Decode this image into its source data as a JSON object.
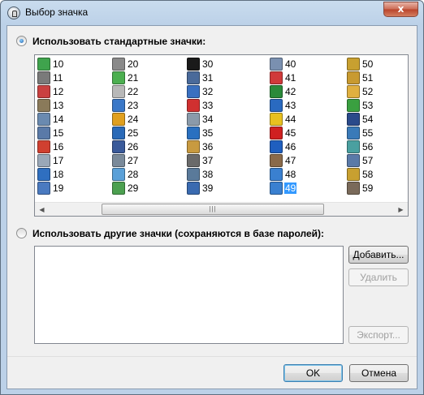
{
  "window": {
    "title": "Выбор значка",
    "close_label": "x"
  },
  "standard": {
    "label": "Использовать стандартные значки:",
    "selected": true,
    "selected_icon": "49",
    "columns": [
      [
        {
          "num": "10",
          "icon": "checkmark-doc-icon",
          "color": "#3fa34d"
        },
        {
          "num": "11",
          "icon": "camera-icon",
          "color": "#7a7a7a"
        },
        {
          "num": "12",
          "icon": "clock-icon",
          "color": "#c94040"
        },
        {
          "num": "13",
          "icon": "tools-icon",
          "color": "#8a7a5a"
        },
        {
          "num": "14",
          "icon": "disk-drive-icon",
          "color": "#6a8ab0"
        },
        {
          "num": "15",
          "icon": "printer-icon",
          "color": "#5a7aa8"
        },
        {
          "num": "16",
          "icon": "star-burst-icon",
          "color": "#d04030"
        },
        {
          "num": "17",
          "icon": "cd-icon",
          "color": "#9aa8b8"
        },
        {
          "num": "18",
          "icon": "monitor-icon",
          "color": "#2f6fc0"
        },
        {
          "num": "19",
          "icon": "mail-icon",
          "color": "#4a7ac0"
        }
      ],
      [
        {
          "num": "20",
          "icon": "gear-icon",
          "color": "#8a8a8a"
        },
        {
          "num": "21",
          "icon": "notepad-icon",
          "color": "#4caf50"
        },
        {
          "num": "22",
          "icon": "document-icon",
          "color": "#b8b8b8"
        },
        {
          "num": "23",
          "icon": "screen-icon",
          "color": "#3a78c8"
        },
        {
          "num": "24",
          "icon": "people-icon",
          "color": "#e0a020"
        },
        {
          "num": "25",
          "icon": "network-icon",
          "color": "#2a6ab8"
        },
        {
          "num": "26",
          "icon": "save-disk-icon",
          "color": "#3a5a9a"
        },
        {
          "num": "27",
          "icon": "computer-icon",
          "color": "#7a8a9a"
        },
        {
          "num": "28",
          "icon": "search-doc-icon",
          "color": "#5aa0d8"
        },
        {
          "num": "29",
          "icon": "ticket-icon",
          "color": "#4ca050"
        }
      ],
      [
        {
          "num": "30",
          "icon": "console-icon",
          "color": "#1a1a1a"
        },
        {
          "num": "31",
          "icon": "printer-2-icon",
          "color": "#4a6a9a"
        },
        {
          "num": "32",
          "icon": "grid-icon",
          "color": "#3a70c0"
        },
        {
          "num": "33",
          "icon": "puzzle-icon",
          "color": "#d03030"
        },
        {
          "num": "34",
          "icon": "wrench-icon",
          "color": "#8a9aaa"
        },
        {
          "num": "35",
          "icon": "users-icon",
          "color": "#2a70c0"
        },
        {
          "num": "36",
          "icon": "package-icon",
          "color": "#c89a40"
        },
        {
          "num": "37",
          "icon": "percent-icon",
          "color": "#6a6a6a"
        },
        {
          "num": "38",
          "icon": "terminal-icon",
          "color": "#5a7a9a"
        },
        {
          "num": "39",
          "icon": "stopwatch-icon",
          "color": "#3a6ab0"
        }
      ],
      [
        {
          "num": "40",
          "icon": "envelope-icon",
          "color": "#7a90b0"
        },
        {
          "num": "41",
          "icon": "thumbs-icon",
          "color": "#d03a3a"
        },
        {
          "num": "42",
          "icon": "chip-icon",
          "color": "#2a8a3a"
        },
        {
          "num": "43",
          "icon": "database-icon",
          "color": "#2a6ac0"
        },
        {
          "num": "44",
          "icon": "sticky-note-icon",
          "color": "#e8c020"
        },
        {
          "num": "45",
          "icon": "cross-icon",
          "color": "#d02020"
        },
        {
          "num": "46",
          "icon": "help-icon",
          "color": "#1f5fbf"
        },
        {
          "num": "47",
          "icon": "trash-icon",
          "color": "#8a6a4a"
        },
        {
          "num": "48",
          "icon": "folder-blue-icon",
          "color": "#3a80d0"
        },
        {
          "num": "49",
          "icon": "folder-open-icon",
          "color": "#3a80d0"
        }
      ],
      [
        {
          "num": "50",
          "icon": "safe-icon",
          "color": "#c8a030"
        },
        {
          "num": "51",
          "icon": "padlock-icon",
          "color": "#c89a30"
        },
        {
          "num": "52",
          "icon": "home-lock-icon",
          "color": "#e0b040"
        },
        {
          "num": "53",
          "icon": "check-icon",
          "color": "#3aa040"
        },
        {
          "num": "54",
          "icon": "pen-icon",
          "color": "#2a4a8a"
        },
        {
          "num": "55",
          "icon": "picture-icon",
          "color": "#3a7ab8"
        },
        {
          "num": "56",
          "icon": "eraser-icon",
          "color": "#4aa0a0"
        },
        {
          "num": "57",
          "icon": "calendar-icon",
          "color": "#5a7aa8"
        },
        {
          "num": "58",
          "icon": "keys-icon",
          "color": "#c8a030"
        },
        {
          "num": "59",
          "icon": "hammer-icon",
          "color": "#7a6a5a"
        }
      ]
    ],
    "scroll_grip": "|||"
  },
  "custom": {
    "label": "Использовать другие значки (сохраняются в базе паролей):",
    "selected": false,
    "add_label": "Добавить...",
    "delete_label": "Удалить",
    "export_label": "Экспорт..."
  },
  "footer": {
    "ok_label": "OK",
    "cancel_label": "Отмена"
  }
}
